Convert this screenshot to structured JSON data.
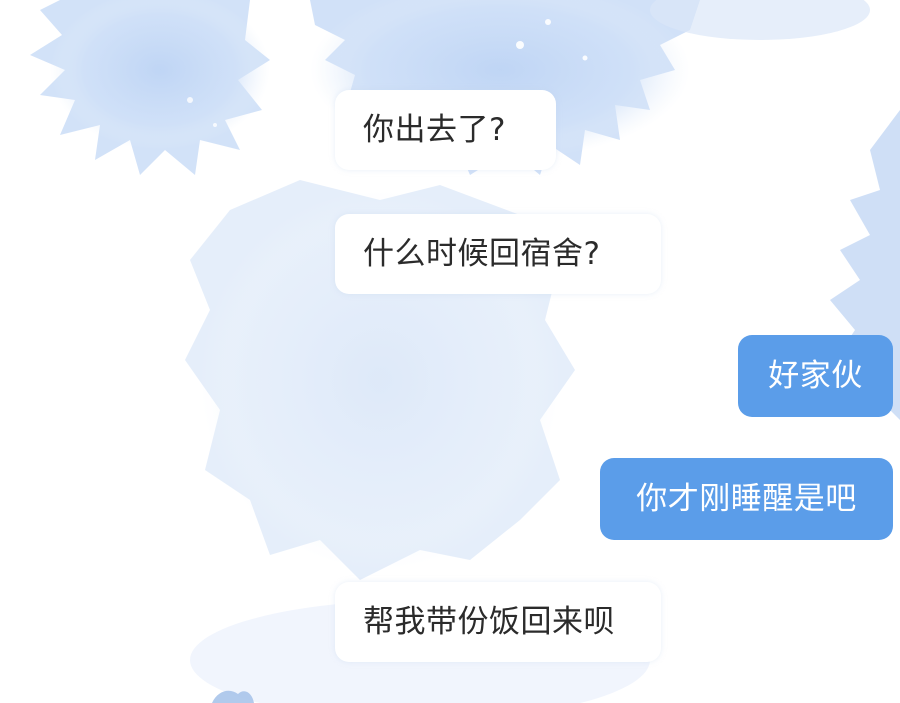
{
  "colors": {
    "incoming_bubble": "#ffffff",
    "incoming_text": "#2b2b2b",
    "outgoing_bubble": "#5b9de9",
    "outgoing_text": "#ffffff",
    "watercolor": "#c9dcf6"
  },
  "messages": [
    {
      "side": "incoming",
      "text": "你出去了?"
    },
    {
      "side": "incoming",
      "text": "什么时候回宿舍?"
    },
    {
      "side": "outgoing",
      "text": "好家伙"
    },
    {
      "side": "outgoing",
      "text": "你才刚睡醒是吧"
    },
    {
      "side": "incoming",
      "text": "帮我带份饭回来呗"
    }
  ]
}
